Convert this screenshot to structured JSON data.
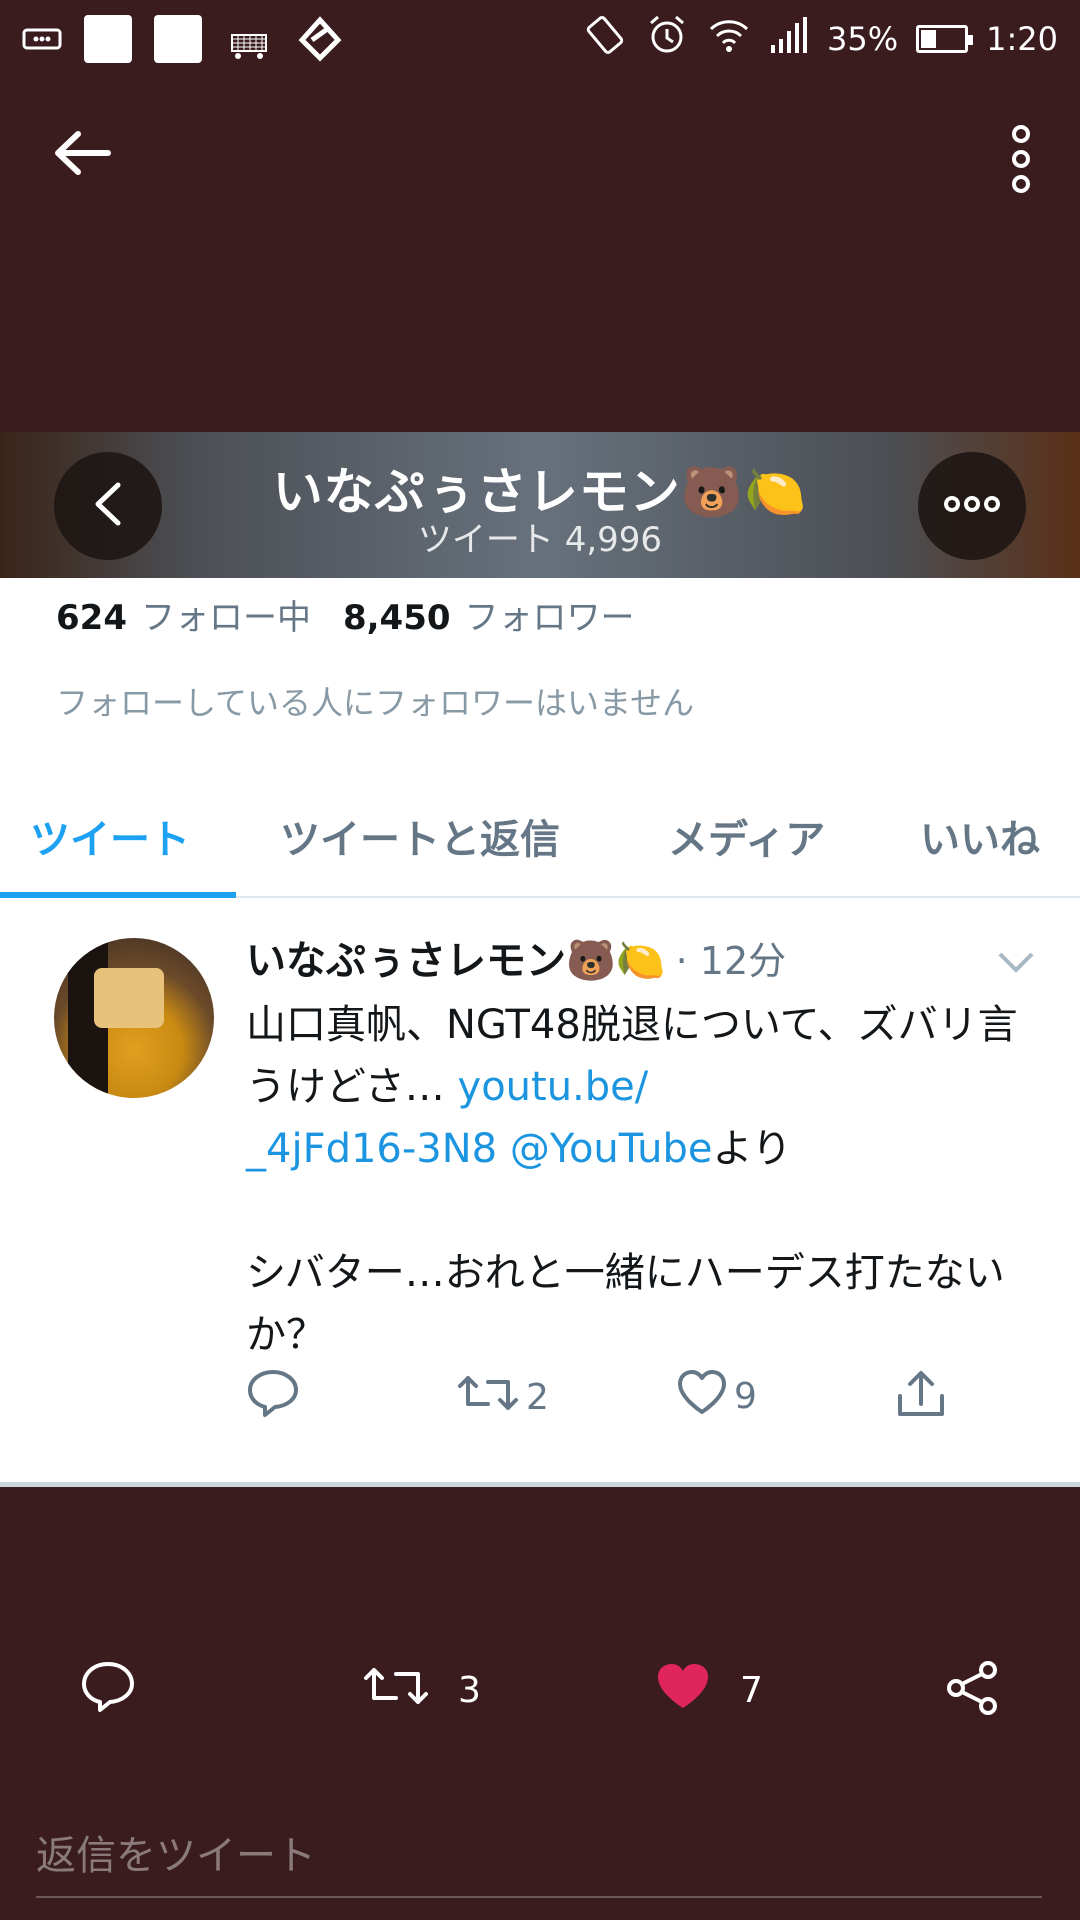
{
  "status_bar": {
    "battery_percent": "35%",
    "battery_level": 0.35,
    "time": "1:20",
    "icons": [
      "voicemail-icon",
      "amazon-icon",
      "app-icon",
      "vibrate-icon",
      "alarm-icon",
      "wifi-icon",
      "signal-icon",
      "battery-icon"
    ]
  },
  "nav": {
    "back_icon": "arrow-left-icon",
    "menu_icon": "kebab-menu-icon"
  },
  "profile": {
    "name": "いなぷぅさレモン🐻🍋",
    "tweet_count_label": "ツイート 4,996",
    "following_count": "624",
    "following_label": "フォロー中",
    "followers_count": "8,450",
    "followers_label": "フォロワー",
    "mutual_note": "フォローしている人にフォロワーはいません"
  },
  "tabs": [
    {
      "label": "ツイート",
      "active": true
    },
    {
      "label": "ツイートと返信",
      "active": false
    },
    {
      "label": "メディア",
      "active": false
    },
    {
      "label": "いいね",
      "active": false
    }
  ],
  "tweet": {
    "author": "いなぷぅさレモン🐻🍋",
    "time": "· 12分",
    "text_1": "山口真帆、NGT48脱退について、ズバリ言うけどさ… ",
    "link_1": "youtu.be/\n_4jFd16-3N8",
    "link_2": " @YouTube",
    "text_2": "より\n\nシバター…おれと一緒にハーデス打たないか？",
    "retweets": "2",
    "likes": "9"
  },
  "bottom_bar": {
    "retweets": "3",
    "likes": "7",
    "like_color": "#e0245e",
    "reply_placeholder": "返信をツイート"
  }
}
